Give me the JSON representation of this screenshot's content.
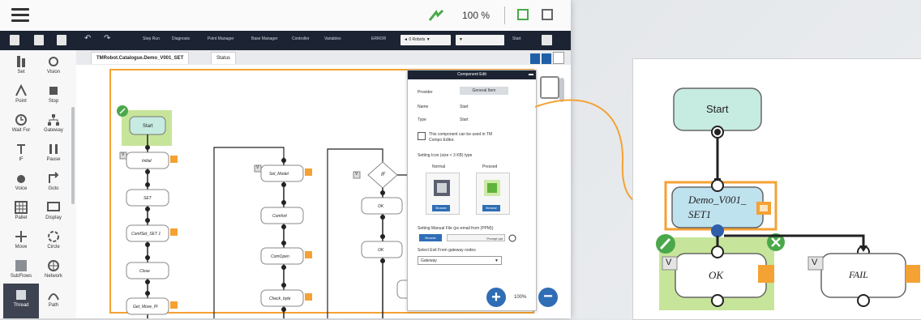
{
  "topbar": {
    "zoom": "100 %"
  },
  "toolbar": {
    "items": [
      "Step Run",
      "Diagnosis",
      "Point Manager",
      "Base Manager",
      "Controller",
      "Variables"
    ],
    "mode_label": "ERROR",
    "dropdown1": "◄ 0 Robots ▼",
    "dropdown2": "▼",
    "start_label": "Start"
  },
  "node_panel": {
    "items": [
      "Set",
      "Vision",
      "Point",
      "Stop",
      "Wait For",
      "Gateway",
      "IF",
      "Pause",
      "Voice",
      "Goto",
      "Pallet",
      "Display",
      "Move",
      "Circle",
      "SubFlows",
      "Network",
      "Thread",
      "Path"
    ]
  },
  "tabs": {
    "project_tab": "TMRobot.Catalogue.Demo_V001_SET",
    "status_tab": "Status"
  },
  "flow": {
    "start": "Start",
    "col1": [
      "Initial",
      "SET",
      "ComfSet_SET 1",
      "Close",
      "Get_Move_PI"
    ],
    "col2": [
      "Set_Model",
      "Comfort",
      "ComOpen",
      "Check_byte"
    ],
    "col3": [
      "IF",
      "OK",
      "OK"
    ],
    "v_label": "V"
  },
  "component_edit": {
    "title": "Component Edit",
    "provider_label": "Provider",
    "provider_value": "General Item",
    "name_label": "Name",
    "name_value": "Start",
    "type_label": "Type",
    "type_value": "Start",
    "checkbox_text": "This component can be used in TM Compo Editor.",
    "setting_label": "Setting Icon (size < 3 KB) type",
    "normal_label": "Normal",
    "pressed_label": "Pressed",
    "browse_label": "Browse",
    "manual_label": "Setting Manual File (pc-email from (PPM))",
    "browse2": "Browse",
    "textfield": "Prompt opt",
    "select_label": "Select Exit From gateway nodes",
    "select_value": "Gateway"
  },
  "canvas": {
    "zoom": "100%"
  },
  "callout": {
    "start": "Start",
    "demo_line1": "Demo_V001_",
    "demo_line2": "SET1",
    "ok": "OK",
    "fail": "FAIL",
    "v": "V"
  },
  "colors": {
    "accent_orange": "#f4a233",
    "start_fill": "#c6ebe0",
    "highlight_green": "#c7e59a",
    "demo_fill": "#bfe2ef",
    "toolbar_dark": "#1c2433",
    "primary_blue": "#2f6db5"
  }
}
